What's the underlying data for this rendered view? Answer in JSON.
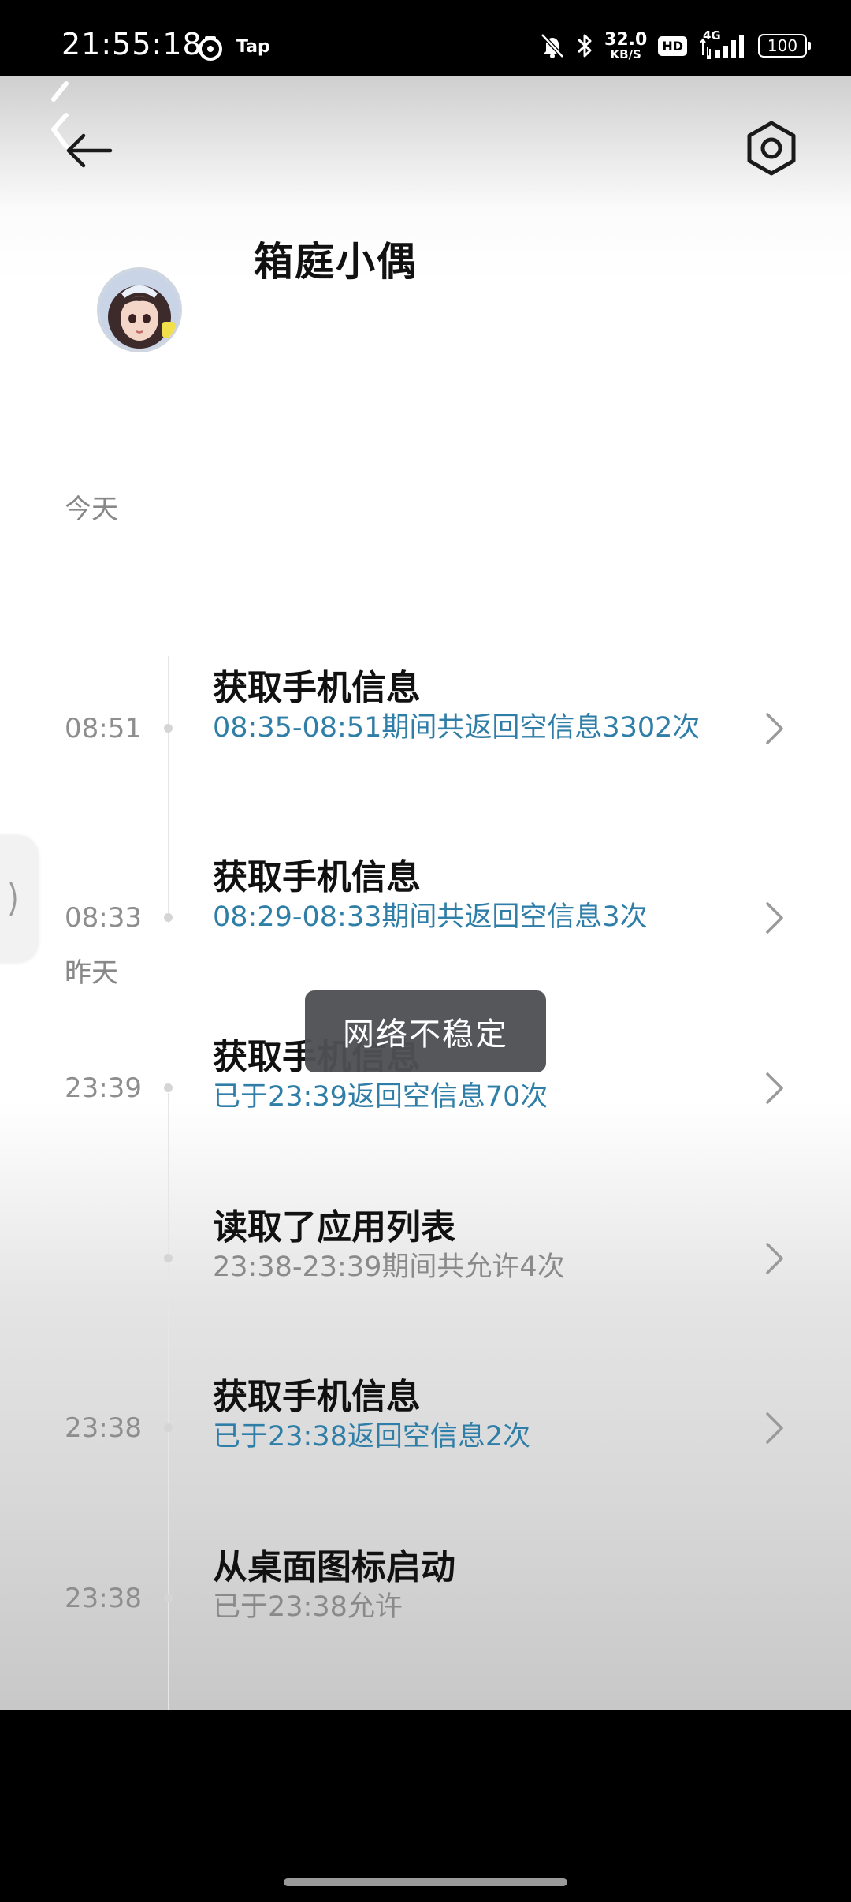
{
  "status_bar": {
    "time": "21:55:18",
    "tap_label": "Tap",
    "net_speed_value": "32.0",
    "net_speed_unit": "KB/S",
    "hd_label": "HD",
    "network_label": "4G",
    "battery": "100",
    "icons": [
      "taptap-app-icon",
      "mute-bell-icon",
      "bluetooth-icon",
      "signal-icon",
      "battery-icon"
    ]
  },
  "header": {
    "back_icon": "arrow-left-icon",
    "settings_icon": "hexagon-gear-icon"
  },
  "app": {
    "name": "箱庭小偶",
    "avatar_icon": "doll-avatar"
  },
  "timeline": {
    "today_label": "今天",
    "yesterday_label": "昨天",
    "today": [
      {
        "time": "08:51",
        "title": "获取手机信息",
        "desc": "08:35-08:51期间共返回空信息3302次",
        "desc_color": "#2f7ea8"
      },
      {
        "time": "08:33",
        "title": "获取手机信息",
        "desc": "08:29-08:33期间共返回空信息3次",
        "desc_color": "#2f7ea8"
      }
    ],
    "yesterday": [
      {
        "time": "23:39",
        "title": "获取手机信息",
        "desc": "已于23:39返回空信息70次",
        "desc_color": "#2f7ea8"
      },
      {
        "time": "",
        "title": "读取了应用列表",
        "desc": "23:38-23:39期间共允许4次",
        "desc_color": "#8a8a8a"
      },
      {
        "time": "23:38",
        "title": "获取手机信息",
        "desc": "已于23:38返回空信息2次",
        "desc_color": "#2f7ea8"
      },
      {
        "time": "23:38",
        "title": "从桌面图标启动",
        "desc": "已于23:38允许",
        "desc_color": "#8a8a8a"
      }
    ]
  },
  "toast": {
    "text": "网络不稳定"
  }
}
